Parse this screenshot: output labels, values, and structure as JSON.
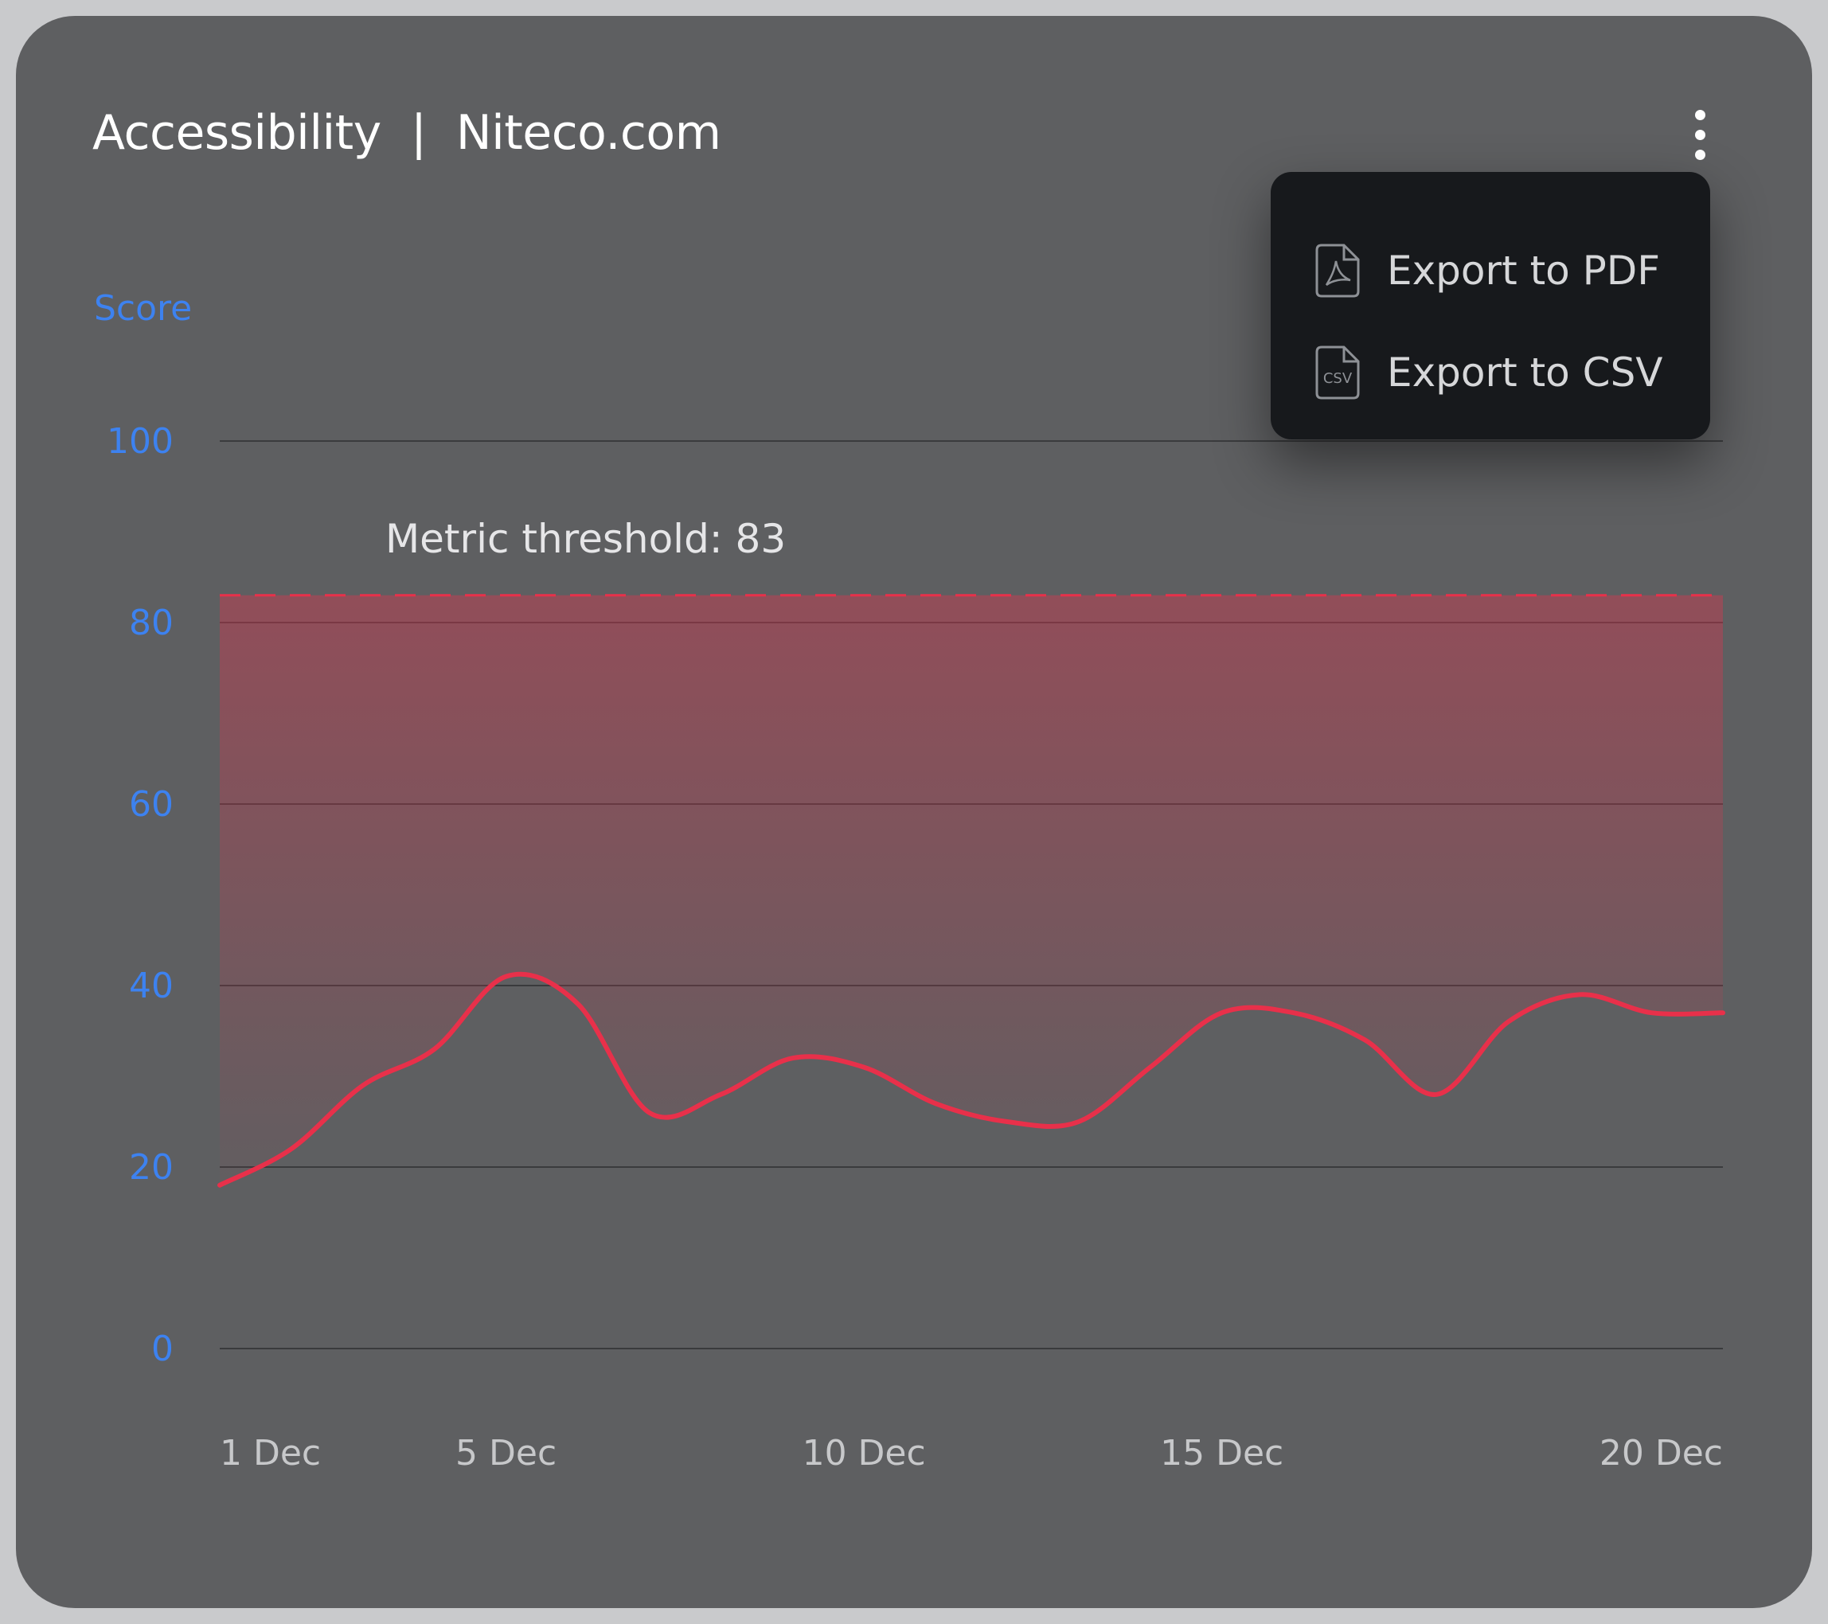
{
  "widget": {
    "title": "Accessibility  |  Niteco.com"
  },
  "menu": {
    "items": [
      {
        "label": "Export to PDF",
        "icon": "pdf-file-icon"
      },
      {
        "label": "Export to CSV",
        "icon": "csv-file-icon"
      }
    ],
    "csv_icon_text": "CSV"
  },
  "chart_data": {
    "type": "line",
    "ylabel": "Score",
    "ylim": [
      0,
      100
    ],
    "yticks": [
      0,
      20,
      40,
      60,
      80,
      100
    ],
    "xlim": [
      "2023-12-01",
      "2023-12-22"
    ],
    "xticks": [
      {
        "date": "2023-12-01",
        "label": "1 Dec"
      },
      {
        "date": "2023-12-05",
        "label": "5 Dec"
      },
      {
        "date": "2023-12-10",
        "label": "10 Dec"
      },
      {
        "date": "2023-12-15",
        "label": "15 Dec"
      },
      {
        "date": "2023-12-20",
        "label": "20 Dec"
      }
    ],
    "grid": true,
    "threshold": {
      "value": 83,
      "label": "Metric threshold: 83"
    },
    "series": [
      {
        "x": [
          "2023-12-01",
          "2023-12-02",
          "2023-12-03",
          "2023-12-04",
          "2023-12-05",
          "2023-12-06",
          "2023-12-07",
          "2023-12-08",
          "2023-12-09",
          "2023-12-10",
          "2023-12-11",
          "2023-12-12",
          "2023-12-13",
          "2023-12-14",
          "2023-12-15",
          "2023-12-16",
          "2023-12-17",
          "2023-12-18",
          "2023-12-19",
          "2023-12-20",
          "2023-12-21",
          "2023-12-22"
        ],
        "values": [
          18,
          22,
          29,
          33,
          41,
          38,
          26,
          28,
          32,
          31,
          27,
          25,
          25,
          31,
          37,
          37,
          34,
          28,
          36,
          39,
          37,
          37
        ],
        "color": "#e8304a"
      }
    ],
    "colors": {
      "line": "#e8304a",
      "threshold": "#e8304a",
      "grid": "#3a3b3d",
      "axis_text": "#3d82f0",
      "x_text": "#c7c8ca"
    }
  }
}
